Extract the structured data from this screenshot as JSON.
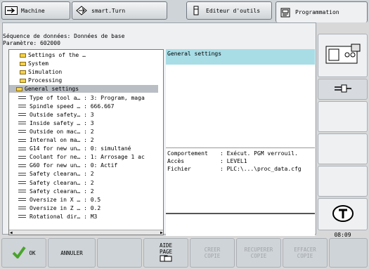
{
  "tabs": [
    {
      "label": "Machine",
      "icon": "machine-arrow-icon"
    },
    {
      "label": "smart.Turn",
      "icon": "smart-turn-icon"
    },
    {
      "label": "Editeur d'outils",
      "icon": "tool-editor-icon"
    },
    {
      "label": "Programmation",
      "icon": "programming-icon"
    }
  ],
  "header": {
    "sequence": "Séquence de données: Données de base",
    "parameter": "Paramètre: 602000"
  },
  "tree": [
    {
      "label": "Settings of the …",
      "type": "folder",
      "indent": 1
    },
    {
      "label": "System",
      "type": "folder",
      "indent": 1
    },
    {
      "label": "Simulation",
      "type": "folder",
      "indent": 1
    },
    {
      "label": "Processing",
      "type": "folder",
      "indent": 1
    },
    {
      "label": "General settings",
      "type": "folder",
      "indent": 2,
      "selected": true
    },
    {
      "label": "Type of tool a… : 3: Program, maga",
      "type": "param",
      "indent": 3
    },
    {
      "label": "Spindle speed … : 666.667",
      "type": "param",
      "indent": 3
    },
    {
      "label": "Outside safety… : 3",
      "type": "param",
      "indent": 3
    },
    {
      "label": "Inside safety … : 3",
      "type": "param",
      "indent": 3
    },
    {
      "label": "Outside on mac… : 2",
      "type": "param",
      "indent": 3
    },
    {
      "label": "Internal on ma… : 2",
      "type": "param",
      "indent": 3
    },
    {
      "label": "G14 for new un… : 0: simultané",
      "type": "param",
      "indent": 3
    },
    {
      "label": "Coolant for ne… : 1: Arrosage 1 ac",
      "type": "param",
      "indent": 3
    },
    {
      "label": "G60 for new un… : 0: Actif",
      "type": "param",
      "indent": 3
    },
    {
      "label": "Safety clearan… : 2",
      "type": "param",
      "indent": 3
    },
    {
      "label": "Safety clearan… : 2",
      "type": "param",
      "indent": 3
    },
    {
      "label": "Safety clearan… : 2",
      "type": "param",
      "indent": 3
    },
    {
      "label": "Oversize in X … : 0.5",
      "type": "param",
      "indent": 3
    },
    {
      "label": "Oversize in Z … : 0.2",
      "type": "param",
      "indent": 3
    },
    {
      "label": "Rotational dir… : M3",
      "type": "param",
      "indent": 3
    }
  ],
  "info": {
    "title": "General settings",
    "fields": [
      {
        "key": "Comportement",
        "value": ": Exécut. PGM verrouil."
      },
      {
        "key": "Accès",
        "value": ": LEVEL1"
      },
      {
        "key": "Fichier",
        "value": ": PLC:\\...\\proc_data.cfg"
      }
    ]
  },
  "clock": "08:09",
  "bottom_keys": [
    {
      "label": "OK",
      "enabled": true,
      "icon": "checkmark-icon"
    },
    {
      "label": "ANNULER",
      "enabled": true
    },
    {
      "label": "",
      "enabled": true
    },
    {
      "label": "AIDE PAGE",
      "enabled": true,
      "icon": "help-page-icon"
    },
    {
      "label": "CREER COPIE",
      "enabled": false
    },
    {
      "label": "RECUPERER COPIE",
      "enabled": false
    },
    {
      "label": "EFFACER COPIE",
      "enabled": false
    },
    {
      "label": "",
      "enabled": true
    }
  ],
  "accent_colors": {
    "info_header": "#a8dde6",
    "selection": "#b9bec4",
    "ok_check": "#4aa32c"
  }
}
